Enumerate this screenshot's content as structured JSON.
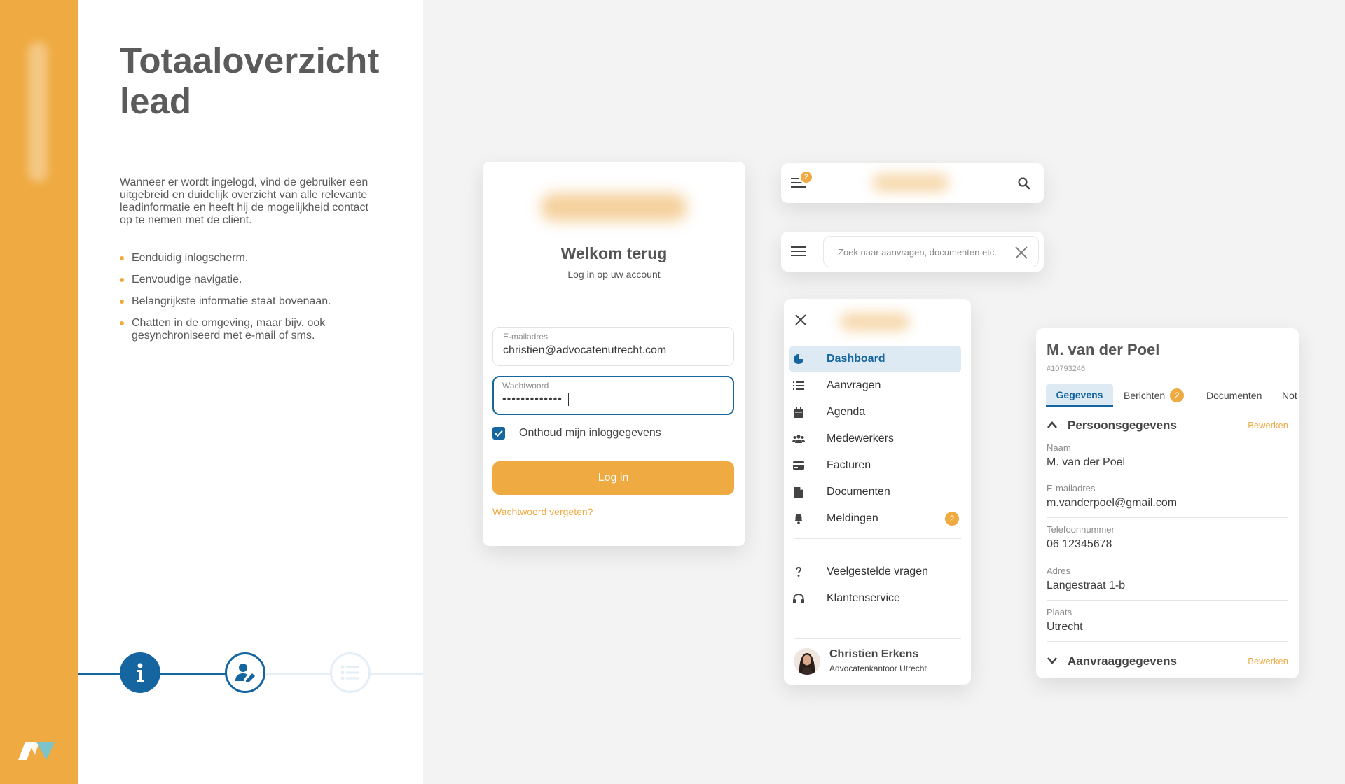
{
  "colors": {
    "accent": "#efab42",
    "primary": "#1565a0",
    "light_blue": "#dde9f3"
  },
  "sidebar_text": {
    "title": "Totaaloverzicht lead",
    "intro": "Wanneer er wordt ingelogd, vind de gebruiker een uitgebreid en duidelijk overzicht van alle relevante leadinformatie en heeft hij de mogelijkheid contact op te nemen met de cliënt.",
    "bullets": [
      "Eenduidig inlogscherm.",
      "Eenvoudige navigatie.",
      "Belangrijkste informatie staat bovenaan.",
      "Chatten in de omgeving, maar bijv. ook gesynchroniseerd met e-mail of sms."
    ]
  },
  "stepper": {
    "steps": [
      {
        "icon": "info-icon",
        "state": "done"
      },
      {
        "icon": "user-edit-icon",
        "state": "current"
      },
      {
        "icon": "list-icon",
        "state": "upcoming"
      }
    ]
  },
  "login": {
    "title": "Welkom terug",
    "subtitle": "Log in op uw account",
    "email_label": "E-mailadres",
    "email_value": "christien@advocatenutrecht.com",
    "password_label": "Wachtwoord",
    "password_value": "•••••••••••••",
    "remember_label": "Onthoud mijn inloggegevens",
    "remember_checked": true,
    "submit_label": "Log in",
    "forgot_label": "Wachtwoord vergeten?"
  },
  "topbar": {
    "menu_badge": "2",
    "search_placeholder": "Zoek naar aanvragen, documenten etc."
  },
  "menu": {
    "items": [
      {
        "label": "Dashboard",
        "icon": "pie-chart-icon",
        "active": true
      },
      {
        "label": "Aanvragen",
        "icon": "list-icon"
      },
      {
        "label": "Agenda",
        "icon": "calendar-icon"
      },
      {
        "label": "Medewerkers",
        "icon": "users-icon"
      },
      {
        "label": "Facturen",
        "icon": "credit-card-icon"
      },
      {
        "label": "Documenten",
        "icon": "file-icon"
      },
      {
        "label": "Meldingen",
        "icon": "bell-icon",
        "badge": "2"
      }
    ],
    "secondary_items": [
      {
        "label": "Veelgestelde vragen",
        "icon": "question-icon"
      },
      {
        "label": "Klantenservice",
        "icon": "headset-icon"
      }
    ],
    "user": {
      "name": "Christien Erkens",
      "company": "Advocatenkantoor Utrecht"
    }
  },
  "detail": {
    "title": "M. van der Poel",
    "id": "#10793246",
    "tabs": [
      {
        "label": "Gegevens",
        "active": true
      },
      {
        "label": "Berichten",
        "badge": "2"
      },
      {
        "label": "Documenten"
      },
      {
        "label": "Not"
      }
    ],
    "section_personal": {
      "title": "Persoonsgegevens",
      "edit": "Bewerken",
      "expanded": true
    },
    "fields": [
      {
        "label": "Naam",
        "value": "M. van der Poel"
      },
      {
        "label": "E-mailadres",
        "value": "m.vanderpoel@gmail.com"
      },
      {
        "label": "Telefoonnummer",
        "value": "06 12345678"
      },
      {
        "label": "Adres",
        "value": "Langestraat 1-b"
      },
      {
        "label": "Plaats",
        "value": "Utrecht"
      }
    ],
    "section_request": {
      "title": "Aanvraaggegevens",
      "edit": "Bewerken",
      "expanded": false
    }
  }
}
